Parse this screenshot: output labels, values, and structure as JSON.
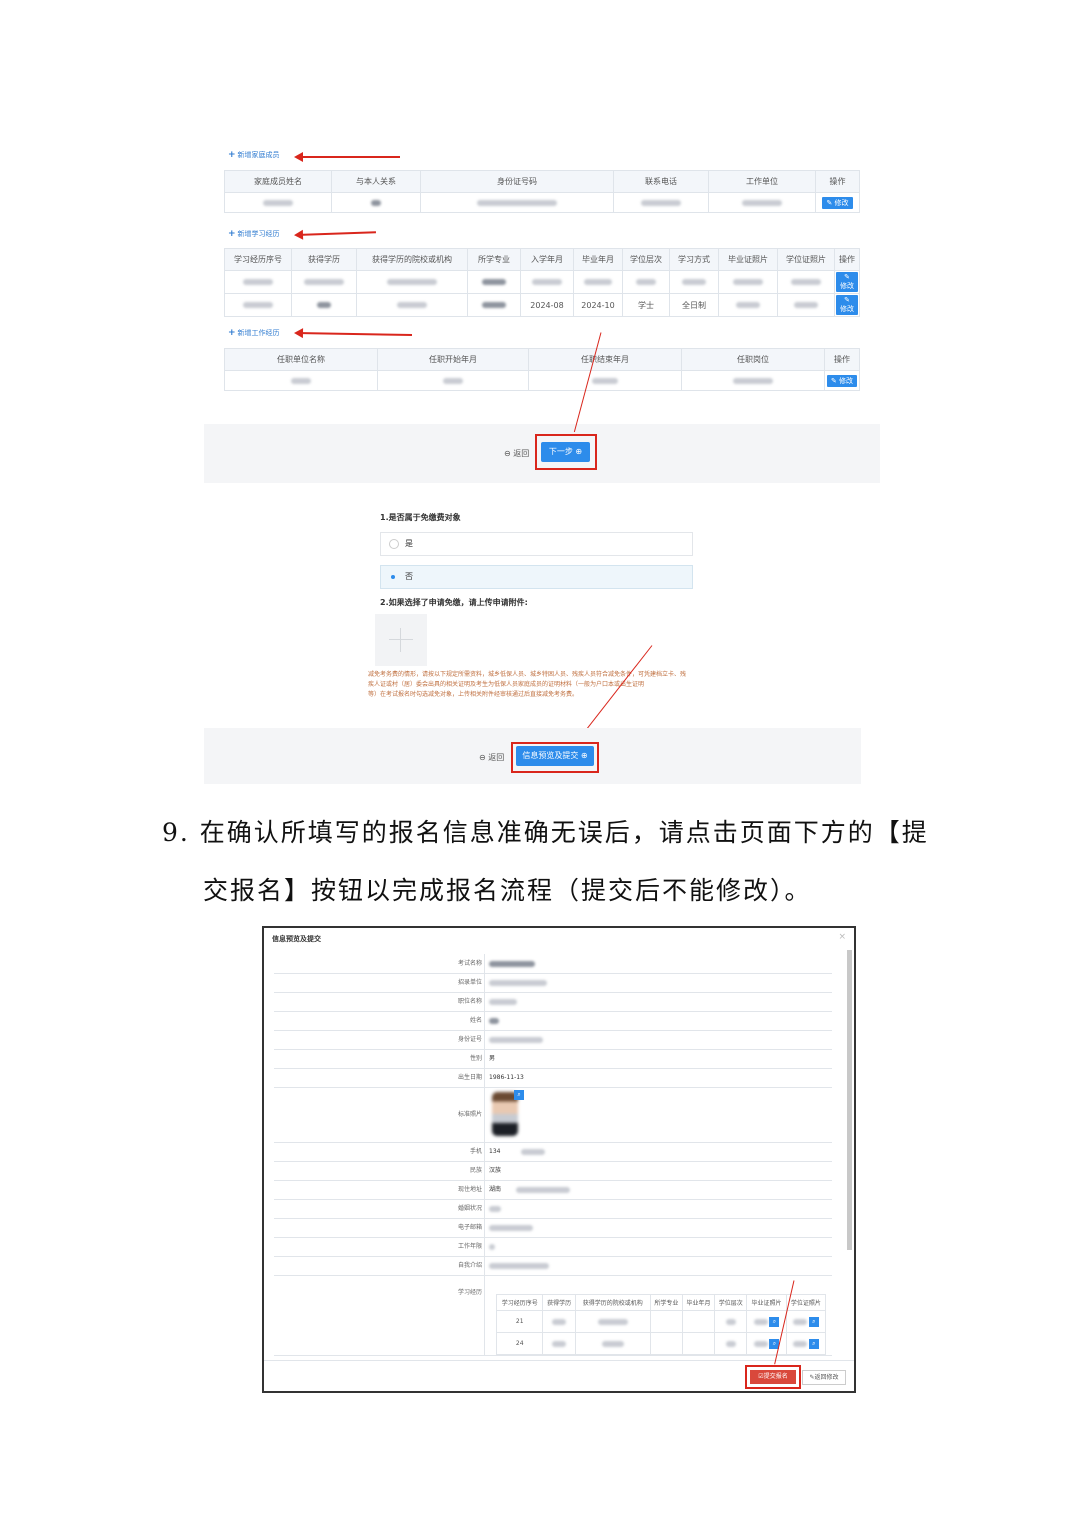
{
  "top_screenshot": {
    "add_family_label": "新增家庭成员",
    "family_headers": [
      "家庭成员姓名",
      "与本人关系",
      "身份证号码",
      "联系电话",
      "工作单位",
      "操作"
    ],
    "add_edu_label": "新增学习经历",
    "edu_headers": [
      "学习经历序号",
      "获得学历",
      "获得学历的院校或机构",
      "所学专业",
      "入学年月",
      "毕业年月",
      "学位层次",
      "学习方式",
      "毕业证照片",
      "学位证照片",
      "操作"
    ],
    "edu_row2_visible": [
      "2024-08",
      "2024-10",
      "学士",
      "全日制"
    ],
    "add_work_label": "新增工作经历",
    "work_headers": [
      "任职单位名称",
      "任职开始年月",
      "任职结束年月",
      "任职岗位",
      "操作"
    ],
    "edit_label": "修改",
    "back_label": "返回",
    "next_label": "下一步"
  },
  "fee_section": {
    "q1": "1.是否属于免缴费对象",
    "opt_yes": "是",
    "opt_no": "否",
    "q2": "2.如果选择了申请免缴，请上传申请附件:",
    "note_line1": "减免考务费的情形，请按以下规定所需资料，城乡低保人员、城乡特困人员、残疾人员符合减免条件，可凭建档立卡、残",
    "note_line2": "疾人证或村（居）委会出具的相关证明及考生为低保人员家庭成员的证明材料（一般为户口本或出生证明",
    "note_line3": "等）在考试报名时勾选减免对象，上传相关附件经审核通过后直接减免考务费。",
    "back_label": "返回",
    "submit_label": "信息预览及提交"
  },
  "instruction": {
    "line1": "9. 在确认所填写的报名信息准确无误后，请点击页面下方的【提",
    "line2": "交报名】按钮以完成报名流程（提交后不能修改）。"
  },
  "modal": {
    "title": "信息预览及提交",
    "close": "×",
    "rows": [
      {
        "label": "考试名称"
      },
      {
        "label": "招录单位"
      },
      {
        "label": "职位名称"
      },
      {
        "label": "姓名"
      },
      {
        "label": "身份证号"
      },
      {
        "label": "性别",
        "value": "男"
      },
      {
        "label": "出生日期",
        "value": "1986-11-13"
      },
      {
        "label": "标准照片"
      },
      {
        "label": "手机",
        "value": "134"
      },
      {
        "label": "民族",
        "value": "汉族"
      },
      {
        "label": "现住地址",
        "value": "湖南"
      },
      {
        "label": "婚姻状况"
      },
      {
        "label": "电子邮箱"
      },
      {
        "label": "工作年限"
      },
      {
        "label": "自我介绍"
      },
      {
        "label": "学习经历"
      }
    ],
    "edu_headers": [
      "学习经历序号",
      "获得学历",
      "获得学历的院校或机构",
      "所学专业",
      "毕业年月",
      "学位层次",
      "毕业证照片",
      "学位证照片"
    ],
    "edu_rows": [
      "21",
      "24"
    ],
    "submit_label": "提交报名",
    "modify_label": "返回修改"
  },
  "colors": {
    "primary": "#2d8ceb",
    "arrow": "#d9261c",
    "submit": "#d9483b"
  }
}
